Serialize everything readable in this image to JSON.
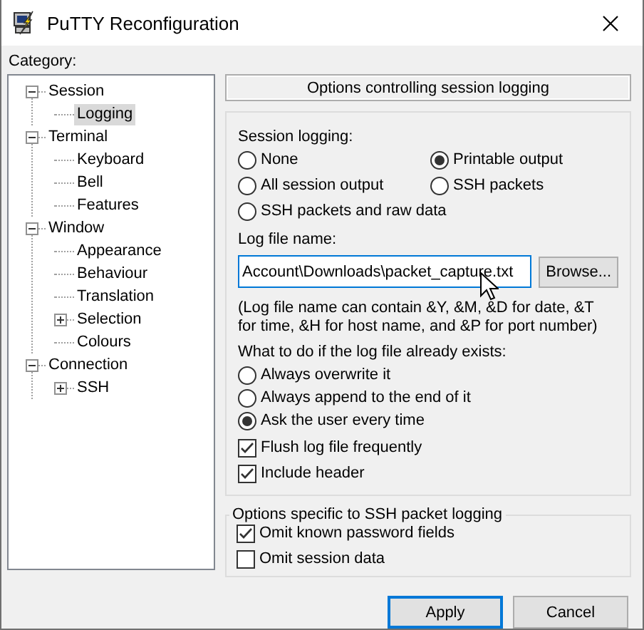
{
  "window": {
    "title": "PuTTY Reconfiguration"
  },
  "category": {
    "label": "Category:",
    "tree": [
      {
        "label": "Session",
        "expanded": true,
        "selected": false,
        "children": [
          {
            "label": "Logging",
            "selected": true
          }
        ]
      },
      {
        "label": "Terminal",
        "expanded": true,
        "selected": false,
        "children": [
          {
            "label": "Keyboard",
            "selected": false
          },
          {
            "label": "Bell",
            "selected": false
          },
          {
            "label": "Features",
            "selected": false
          }
        ]
      },
      {
        "label": "Window",
        "expanded": true,
        "selected": false,
        "children": [
          {
            "label": "Appearance",
            "selected": false
          },
          {
            "label": "Behaviour",
            "selected": false
          },
          {
            "label": "Translation",
            "selected": false
          },
          {
            "label": "Selection",
            "expanded": false,
            "selected": false
          },
          {
            "label": "Colours",
            "selected": false
          }
        ]
      },
      {
        "label": "Connection",
        "expanded": true,
        "selected": false,
        "children": [
          {
            "label": "SSH",
            "expanded": false,
            "selected": false
          }
        ]
      }
    ]
  },
  "panel": {
    "header": "Options controlling session logging",
    "session_logging": {
      "label": "Session logging:",
      "options": [
        {
          "label": "None",
          "selected": false
        },
        {
          "label": "Printable output",
          "selected": true
        },
        {
          "label": "All session output",
          "selected": false
        },
        {
          "label": "SSH packets",
          "selected": false
        },
        {
          "label": "SSH packets and raw data",
          "selected": false
        }
      ]
    },
    "log_file": {
      "label": "Log file name:",
      "value": "Account\\Downloads\\packet_capture.txt",
      "browse": "Browse..."
    },
    "note": "(Log file name can contain &Y, &M, &D for date, &T for time, &H for host name, and &P for port number)",
    "if_exists": {
      "label": "What to do if the log file already exists:",
      "options": [
        {
          "label": "Always overwrite it",
          "selected": false
        },
        {
          "label": "Always append to the end of it",
          "selected": false
        },
        {
          "label": "Ask the user every time",
          "selected": true
        }
      ]
    },
    "checkboxes": [
      {
        "label": "Flush log file frequently",
        "checked": true
      },
      {
        "label": "Include header",
        "checked": true
      }
    ],
    "ssh_group": {
      "title": "Options specific to SSH packet logging",
      "checkboxes": [
        {
          "label": "Omit known password fields",
          "checked": true
        },
        {
          "label": "Omit session data",
          "checked": false
        }
      ]
    }
  },
  "buttons": [
    {
      "label": "Apply",
      "default": true
    },
    {
      "label": "Cancel",
      "default": false
    }
  ]
}
